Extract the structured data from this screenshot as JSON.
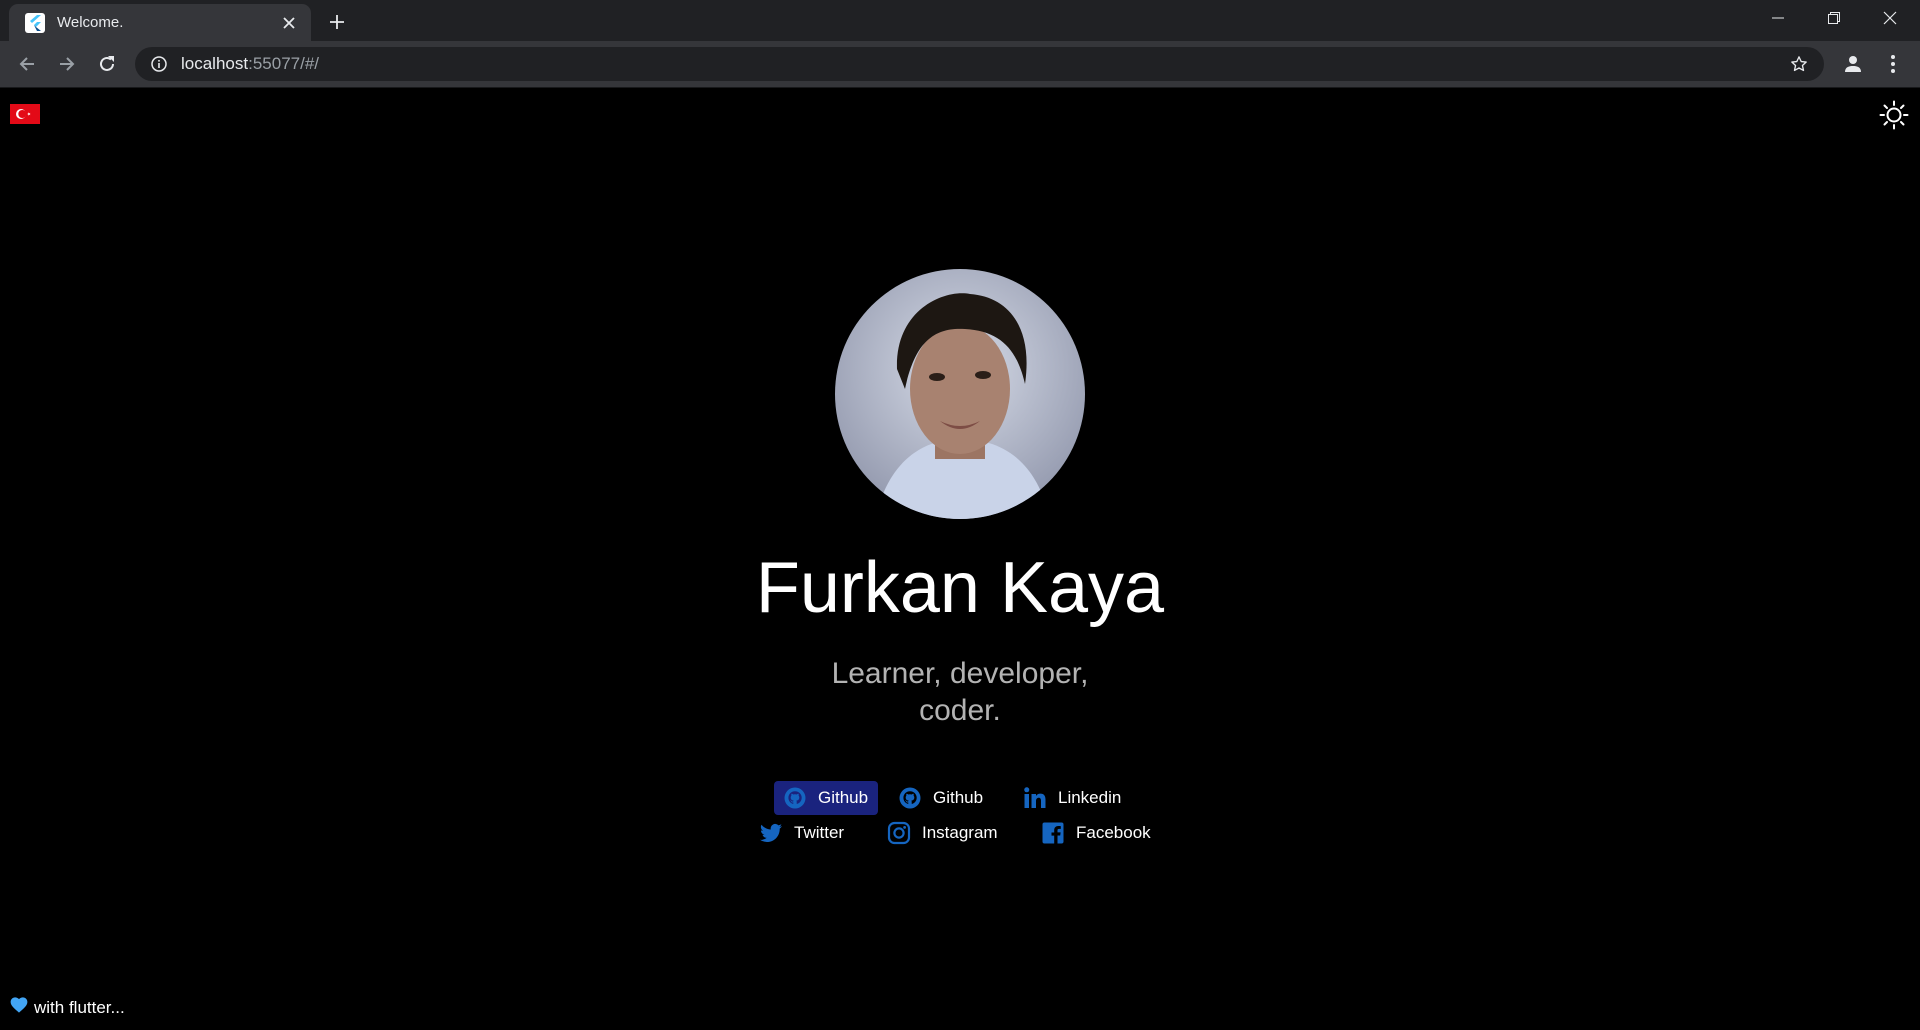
{
  "browser": {
    "tab_title": "Welcome.",
    "url_host": "localhost",
    "url_rest": ":55077/#/"
  },
  "profile": {
    "name": "Furkan Kaya",
    "tagline_line1": "Learner, developer,",
    "tagline_line2": "coder."
  },
  "links": [
    {
      "label": "Github",
      "icon": "github-icon"
    },
    {
      "label": "Github",
      "icon": "github-icon"
    },
    {
      "label": "Linkedin",
      "icon": "linkedin-icon"
    },
    {
      "label": "Twitter",
      "icon": "twitter-icon"
    },
    {
      "label": "Instagram",
      "icon": "instagram-icon"
    },
    {
      "label": "Facebook",
      "icon": "facebook-icon"
    }
  ],
  "footer": {
    "text": "with flutter..."
  },
  "colors": {
    "background": "#000000",
    "accent": "#1565c0",
    "active_button": "#1a237e",
    "flag_red": "#e30a17"
  }
}
